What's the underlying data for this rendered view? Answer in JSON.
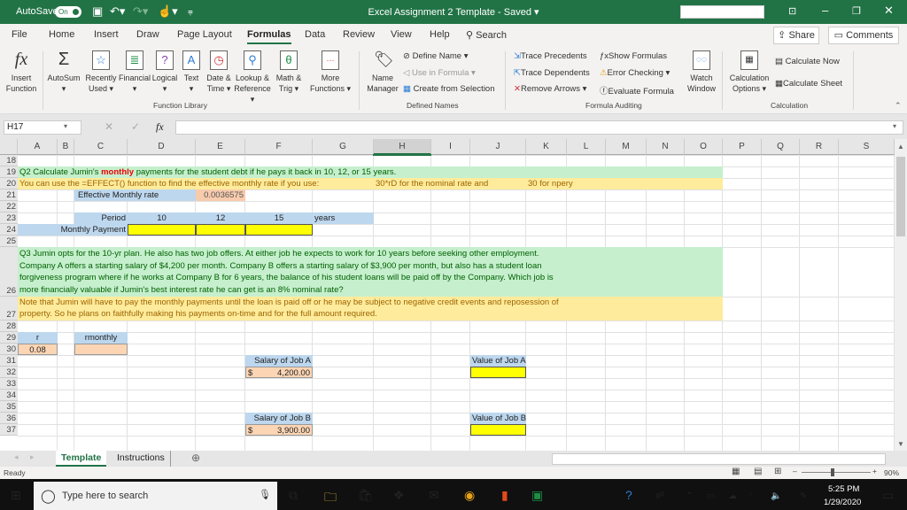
{
  "titlebar": {
    "autosave_label": "AutoSave",
    "autosave_state": "On",
    "title": "Excel Assignment 2 Template  -  Saved ▾",
    "icons": [
      "save-icon",
      "undo-icon",
      "redo-icon",
      "touch-mode-icon",
      "customize-icon"
    ]
  },
  "menu": {
    "items": [
      "File",
      "Home",
      "Insert",
      "Draw",
      "Page Layout",
      "Formulas",
      "Data",
      "Review",
      "View",
      "Help"
    ],
    "active": "Formulas",
    "search": "Search",
    "share": "Share",
    "comments": "Comments"
  },
  "ribbon": {
    "function_library": {
      "label": "Function Library",
      "buttons": [
        {
          "l1": "Insert",
          "l2": "Function",
          "icon": "fx"
        },
        {
          "l1": "AutoSum",
          "l2": "▾",
          "icon": "Σ"
        },
        {
          "l1": "Recently",
          "l2": "Used ▾",
          "icon": "☆"
        },
        {
          "l1": "Financial",
          "l2": "▾",
          "icon": "≣"
        },
        {
          "l1": "Logical",
          "l2": "▾",
          "icon": "?"
        },
        {
          "l1": "Text",
          "l2": "▾",
          "icon": "A"
        },
        {
          "l1": "Date &",
          "l2": "Time ▾",
          "icon": "◷"
        },
        {
          "l1": "Lookup &",
          "l2": "Reference ▾",
          "icon": "⚲"
        },
        {
          "l1": "Math &",
          "l2": "Trig ▾",
          "icon": "θ"
        },
        {
          "l1": "More",
          "l2": "Functions ▾",
          "icon": "···"
        }
      ]
    },
    "defined_names": {
      "label": "Defined Names",
      "name_manager": [
        "Name",
        "Manager"
      ],
      "define_name": "Define Name ▾",
      "use_in_formula": "Use in Formula ▾",
      "create_from_selection": "Create from Selection"
    },
    "formula_auditing": {
      "label": "Formula Auditing",
      "trace_precedents": "Trace Precedents",
      "trace_dependents": "Trace Dependents",
      "remove_arrows": "Remove Arrows ▾",
      "show_formulas": "Show Formulas",
      "error_checking": "Error Checking ▾",
      "evaluate_formula": "Evaluate Formula",
      "watch_window": [
        "Watch",
        "Window"
      ]
    },
    "calculation": {
      "label": "Calculation",
      "options": [
        "Calculation",
        "Options ▾"
      ],
      "calc_now": "Calculate Now",
      "calc_sheet": "Calculate Sheet"
    }
  },
  "formula_bar": {
    "name_box": "H17",
    "fx": "fx",
    "value": ""
  },
  "sheet": {
    "columns": [
      "A",
      "B",
      "C",
      "D",
      "E",
      "F",
      "G",
      "H",
      "I",
      "J",
      "K",
      "L",
      "M",
      "N",
      "O",
      "P",
      "Q",
      "R",
      "S"
    ],
    "selected_column": "H",
    "rows": [
      "18",
      "19",
      "20",
      "21",
      "22",
      "23",
      "24",
      "25",
      "26",
      "27",
      "28",
      "29",
      "30",
      "31",
      "32",
      "33",
      "34",
      "35",
      "36",
      "37"
    ],
    "r19_pre": "Q2 Calculate Jumin's ",
    "r19_bold": "monthly",
    "r19_post": " payments for the student debt if he pays it back in 10, 12, or 15 years.",
    "r20_a": "You can use the =EFFECT() function to find the effective monthly rate if you use:",
    "r20_h": "30*rD for the nominal rate and",
    "r20_k": "30 for npery",
    "r21_label": "Effective Monthly rate",
    "r21_value": "0.0036575",
    "r23_label": "Period",
    "r23_periods": [
      "10",
      "12",
      "15"
    ],
    "r23_unit": "years",
    "r24_label": "Monthly Payment",
    "r26_lines": [
      "Q3 Jumin opts for the 10-yr plan.  He also has two job offers.  At either job he expects to work for 10 years before seeking other employment.",
      "Company A offers a starting salary of $4,200 per month.  Company B offers a starting salary of $3,900 per month, but also has a student loan",
      "forgiveness program where if he works at Company B for 6 years, the balance of his student loans will be paid off by the Company.  Which job is",
      "more financially valuable if Jumin's best interest rate he can get is an 8% nominal rate?"
    ],
    "r27_lines": [
      "Note that Jumin will have to pay the monthly payments until the loan is paid off or he may be subject to negative credit events and reposession of",
      "property.  So he plans on faithfully making his payments on-time and for the full amount required."
    ],
    "r29_r": "r",
    "r29_rmonthly": "rmonthly",
    "r30_r": "0.08",
    "salary_a_label": "Salary of Job A",
    "salary_a_cur": "$",
    "salary_a_value": "4,200.00",
    "value_a_label": "Value of Job A",
    "salary_b_label": "Salary of Job B",
    "salary_b_cur": "$",
    "salary_b_value": "3,900.00",
    "value_b_label": "Value of Job B"
  },
  "tabs": {
    "items": [
      "Template",
      "Instructions"
    ],
    "active": "Template"
  },
  "status": {
    "text": "Ready",
    "zoom": "90%",
    "zoom_value": 0.9
  },
  "taskbar": {
    "search_placeholder": "Type here to search",
    "time": "5:25 PM",
    "date": "1/29/2020"
  }
}
